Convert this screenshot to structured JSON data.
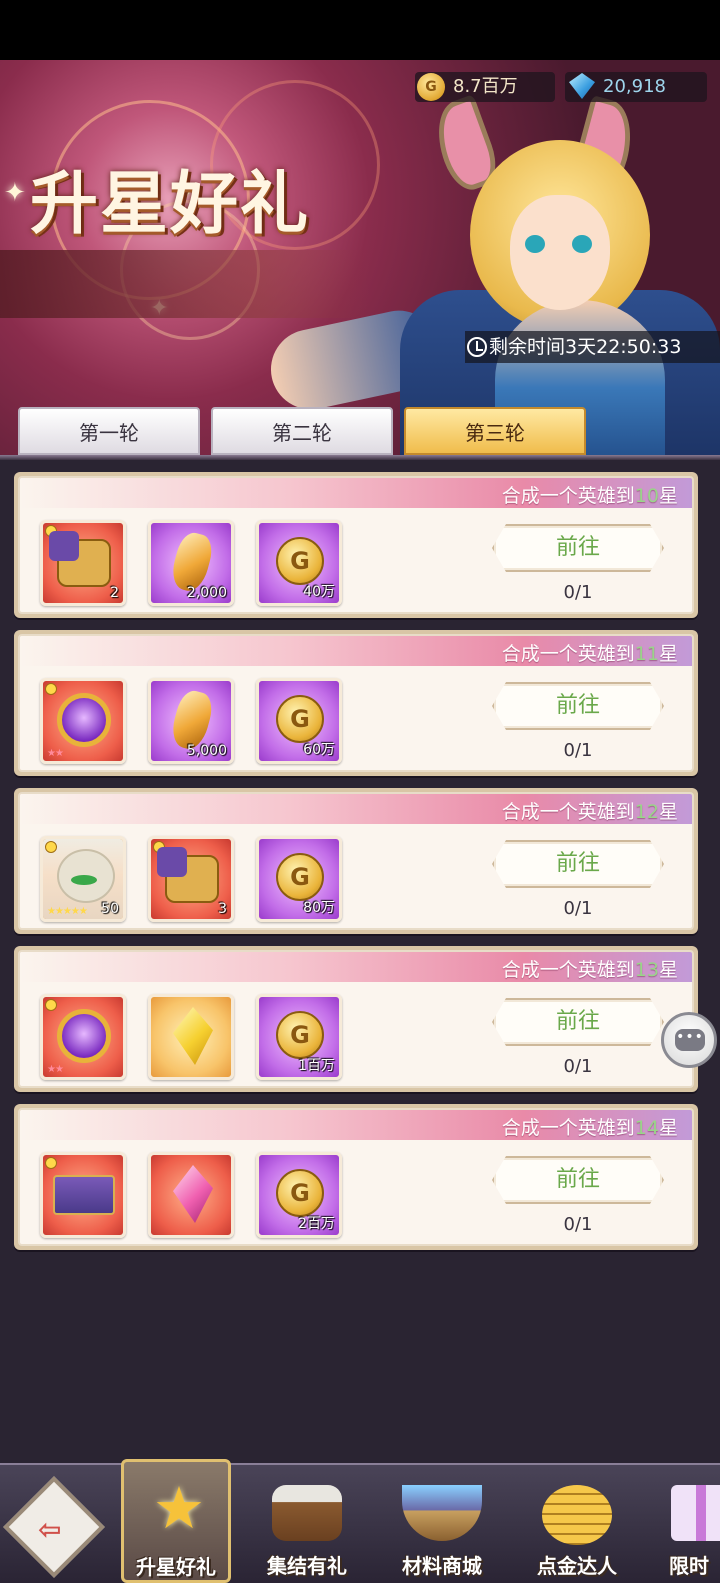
{
  "header": {
    "title": "升星好礼",
    "gold_amount": "8.7百万",
    "gem_amount": "20,918",
    "timer_prefix": "剩余时间",
    "timer_value": "3天22:50:33"
  },
  "tabs": [
    {
      "label": "第一轮",
      "active": false
    },
    {
      "label": "第二轮",
      "active": false
    },
    {
      "label": "第三轮",
      "active": true
    }
  ],
  "quests": [
    {
      "title_prefix": "合成一个英雄到",
      "star_num": "10",
      "title_suffix": "星",
      "button": "前往",
      "progress": "0/1",
      "rewards": [
        {
          "icon": "puzzle-icon",
          "qty": "2"
        },
        {
          "icon": "orange-crystal-icon",
          "qty": "2,000"
        },
        {
          "icon": "gold-coin-icon",
          "qty": "40万"
        }
      ]
    },
    {
      "title_prefix": "合成一个英雄到",
      "star_num": "11",
      "title_suffix": "星",
      "button": "前往",
      "progress": "0/1",
      "rewards": [
        {
          "icon": "hero-ring-icon",
          "qty": ""
        },
        {
          "icon": "orange-crystal-icon",
          "qty": "5,000"
        },
        {
          "icon": "gold-coin-icon",
          "qty": "60万"
        }
      ]
    },
    {
      "title_prefix": "合成一个英雄到",
      "star_num": "12",
      "title_suffix": "星",
      "button": "前往",
      "progress": "0/1",
      "rewards": [
        {
          "icon": "hero-portrait-icon",
          "qty": "50"
        },
        {
          "icon": "puzzle-icon",
          "qty": "3"
        },
        {
          "icon": "gold-coin-icon",
          "qty": "80万"
        }
      ]
    },
    {
      "title_prefix": "合成一个英雄到",
      "star_num": "13",
      "title_suffix": "星",
      "button": "前往",
      "progress": "0/1",
      "rewards": [
        {
          "icon": "hero-ring-icon",
          "qty": ""
        },
        {
          "icon": "yellow-gem-icon",
          "qty": ""
        },
        {
          "icon": "gold-coin-icon",
          "qty": "1百万"
        }
      ]
    },
    {
      "title_prefix": "合成一个英雄到",
      "star_num": "14",
      "title_suffix": "星",
      "button": "前往",
      "progress": "0/1",
      "rewards": [
        {
          "icon": "chest-icon",
          "qty": ""
        },
        {
          "icon": "pink-gem-icon",
          "qty": ""
        },
        {
          "icon": "gold-coin-icon",
          "qty": "2百万"
        }
      ]
    }
  ],
  "bottom_nav": [
    {
      "label": "",
      "icon": "back-icon"
    },
    {
      "label": "升星好礼",
      "icon": "star-icon",
      "active": true
    },
    {
      "label": "集结有礼",
      "icon": "barrel-icon"
    },
    {
      "label": "材料商城",
      "icon": "bowl-icon"
    },
    {
      "label": "点金达人",
      "icon": "coins-icon"
    },
    {
      "label": "限时",
      "icon": "gift-icon"
    }
  ],
  "colors": {
    "accent_tab": "#f0bd4c",
    "go_button_text": "#6aa84a",
    "star_number": "#9ad48a"
  }
}
